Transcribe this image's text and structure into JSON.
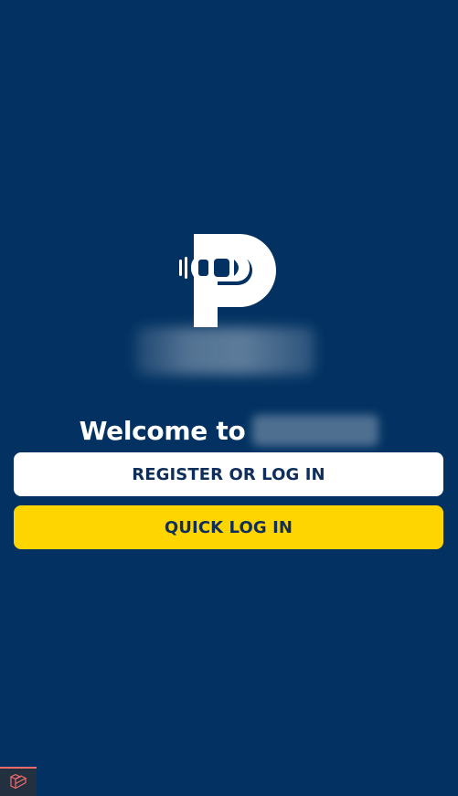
{
  "colors": {
    "background": "#033262",
    "primary_button_bg": "#ffffff",
    "secondary_button_bg": "#ffd500",
    "button_text": "#0f2f5a",
    "dev_badge_accent": "#f26b6b"
  },
  "logo": {
    "icon": "parking-p-car-logo-icon"
  },
  "welcome": {
    "text": "Welcome to"
  },
  "buttons": {
    "register_label": "REGISTER OR LOG IN",
    "quick_label": "QUICK LOG IN"
  },
  "dev_toolbar": {
    "icon": "laravel-icon"
  }
}
